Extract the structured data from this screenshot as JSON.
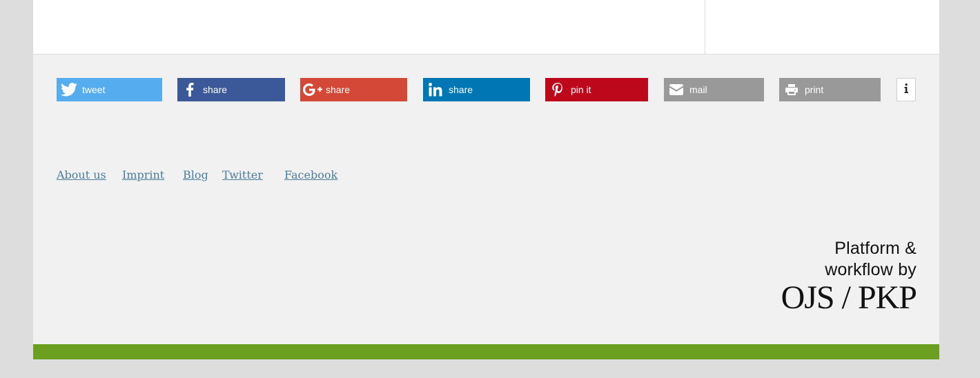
{
  "share_bar": {
    "buttons": [
      {
        "key": "twitter",
        "label": "tweet",
        "icon": "twitter-icon",
        "color": "#55acee"
      },
      {
        "key": "facebook",
        "label": "share",
        "icon": "facebook-icon",
        "color": "#3b5998"
      },
      {
        "key": "gplus",
        "label": "share",
        "icon": "google-plus-icon",
        "color": "#d34836"
      },
      {
        "key": "linkedin",
        "label": "share",
        "icon": "linkedin-icon",
        "color": "#0077b5"
      },
      {
        "key": "pinterest",
        "label": "pin it",
        "icon": "pinterest-icon",
        "color": "#bd081c"
      },
      {
        "key": "mail",
        "label": "mail",
        "icon": "envelope-icon",
        "color": "#999999"
      },
      {
        "key": "print",
        "label": "print",
        "icon": "printer-icon",
        "color": "#999999"
      }
    ],
    "info_icon": "info-icon"
  },
  "footer": {
    "links": [
      "About us",
      "Imprint",
      "Blog",
      "Twitter",
      "Facebook"
    ],
    "link_color": "#4b7d9b"
  },
  "branding": {
    "line1": "Platform &",
    "line2": "workflow by",
    "logo_text": "OJS / PKP"
  },
  "colors": {
    "page_bg": "#dddddd",
    "footer_bg": "#f1f1f1",
    "accent_bar": "#6a9f1f"
  }
}
